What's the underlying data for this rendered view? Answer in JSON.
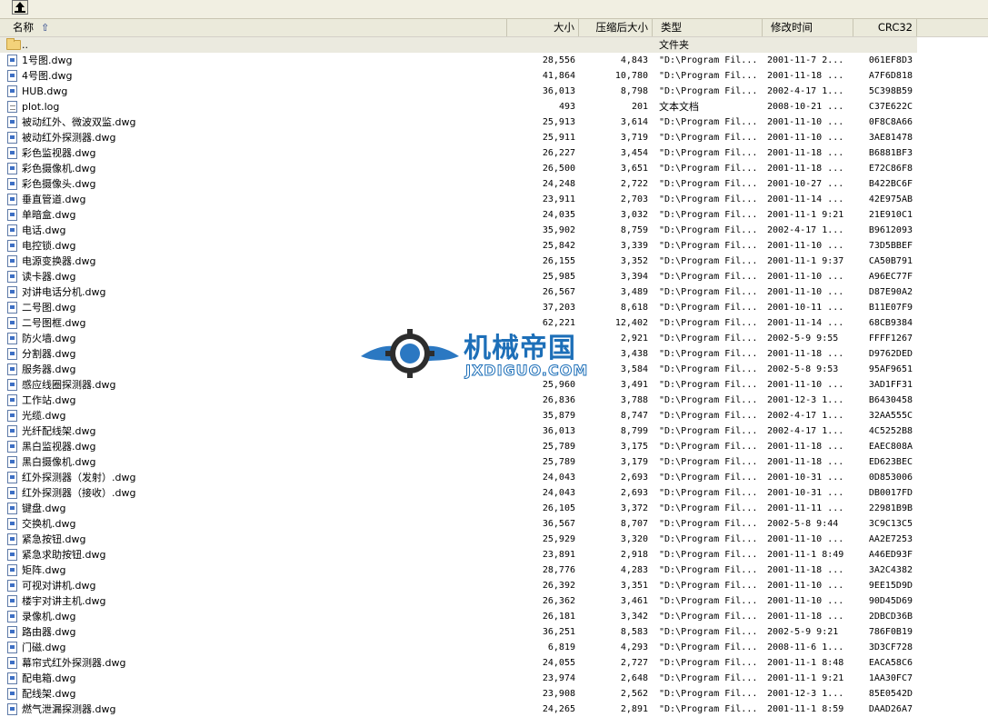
{
  "columns": {
    "name": "名称",
    "size": "大小",
    "compressed": "压缩后大小",
    "type": "类型",
    "modified": "修改时间",
    "crc": "CRC32"
  },
  "icons": {
    "up": "up-folder-icon",
    "sort": "sort-ascending-icon",
    "folder": "folder-icon",
    "dwg": "dwg-file-icon",
    "log": "text-file-icon"
  },
  "colors": {
    "header_bg": "#ebeadb",
    "selected_row_bg": "#ebeadf",
    "watermark_blue": "#1d6fb8"
  },
  "watermark": {
    "cn": "机械帝国",
    "en": "JXDIGUO.COM"
  },
  "rows": [
    {
      "name": "..",
      "size": "",
      "compressed": "",
      "type": "文件夹",
      "modified": "",
      "crc": "",
      "icon": "folder"
    },
    {
      "name": "1号图.dwg",
      "size": "28,556",
      "compressed": "4,843",
      "type": "\"D:\\Program Fil...",
      "modified": "2001-11-7 2...",
      "crc": "061EF8D3",
      "icon": "dwg"
    },
    {
      "name": "4号图.dwg",
      "size": "41,864",
      "compressed": "10,780",
      "type": "\"D:\\Program Fil...",
      "modified": "2001-11-18 ...",
      "crc": "A7F6D818",
      "icon": "dwg"
    },
    {
      "name": "HUB.dwg",
      "size": "36,013",
      "compressed": "8,798",
      "type": "\"D:\\Program Fil...",
      "modified": "2002-4-17 1...",
      "crc": "5C398B59",
      "icon": "dwg"
    },
    {
      "name": "plot.log",
      "size": "493",
      "compressed": "201",
      "type": "文本文档",
      "modified": "2008-10-21 ...",
      "crc": "C37E622C",
      "icon": "log"
    },
    {
      "name": "被动红外、微波双监.dwg",
      "size": "25,913",
      "compressed": "3,614",
      "type": "\"D:\\Program Fil...",
      "modified": "2001-11-10 ...",
      "crc": "0F8C8A66",
      "icon": "dwg"
    },
    {
      "name": "被动红外探测器.dwg",
      "size": "25,911",
      "compressed": "3,719",
      "type": "\"D:\\Program Fil...",
      "modified": "2001-11-10 ...",
      "crc": "3AE81478",
      "icon": "dwg"
    },
    {
      "name": "彩色监视器.dwg",
      "size": "26,227",
      "compressed": "3,454",
      "type": "\"D:\\Program Fil...",
      "modified": "2001-11-18 ...",
      "crc": "B6881BF3",
      "icon": "dwg"
    },
    {
      "name": "彩色摄像机.dwg",
      "size": "26,500",
      "compressed": "3,651",
      "type": "\"D:\\Program Fil...",
      "modified": "2001-11-18 ...",
      "crc": "E72C86F8",
      "icon": "dwg"
    },
    {
      "name": "彩色摄像头.dwg",
      "size": "24,248",
      "compressed": "2,722",
      "type": "\"D:\\Program Fil...",
      "modified": "2001-10-27 ...",
      "crc": "B422BC6F",
      "icon": "dwg"
    },
    {
      "name": "垂直管道.dwg",
      "size": "23,911",
      "compressed": "2,703",
      "type": "\"D:\\Program Fil...",
      "modified": "2001-11-14 ...",
      "crc": "42E975AB",
      "icon": "dwg"
    },
    {
      "name": "单暗盒.dwg",
      "size": "24,035",
      "compressed": "3,032",
      "type": "\"D:\\Program Fil...",
      "modified": "2001-11-1 9:21",
      "crc": "21E910C1",
      "icon": "dwg"
    },
    {
      "name": "电话.dwg",
      "size": "35,902",
      "compressed": "8,759",
      "type": "\"D:\\Program Fil...",
      "modified": "2002-4-17 1...",
      "crc": "B9612093",
      "icon": "dwg"
    },
    {
      "name": "电控锁.dwg",
      "size": "25,842",
      "compressed": "3,339",
      "type": "\"D:\\Program Fil...",
      "modified": "2001-11-10 ...",
      "crc": "73D5BBEF",
      "icon": "dwg"
    },
    {
      "name": "电源变换器.dwg",
      "size": "26,155",
      "compressed": "3,352",
      "type": "\"D:\\Program Fil...",
      "modified": "2001-11-1 9:37",
      "crc": "CA50B791",
      "icon": "dwg"
    },
    {
      "name": "读卡器.dwg",
      "size": "25,985",
      "compressed": "3,394",
      "type": "\"D:\\Program Fil...",
      "modified": "2001-11-10 ...",
      "crc": "A96EC77F",
      "icon": "dwg"
    },
    {
      "name": "对讲电话分机.dwg",
      "size": "26,567",
      "compressed": "3,489",
      "type": "\"D:\\Program Fil...",
      "modified": "2001-11-10 ...",
      "crc": "D87E90A2",
      "icon": "dwg"
    },
    {
      "name": "二号图.dwg",
      "size": "37,203",
      "compressed": "8,618",
      "type": "\"D:\\Program Fil...",
      "modified": "2001-10-11 ...",
      "crc": "B11E07F9",
      "icon": "dwg"
    },
    {
      "name": "二号图框.dwg",
      "size": "62,221",
      "compressed": "12,402",
      "type": "\"D:\\Program Fil...",
      "modified": "2001-11-14 ...",
      "crc": "68CB9384",
      "icon": "dwg"
    },
    {
      "name": "防火墙.dwg",
      "size": "",
      "compressed": "2,921",
      "type": "\"D:\\Program Fil...",
      "modified": "2002-5-9 9:55",
      "crc": "FFFF1267",
      "icon": "dwg"
    },
    {
      "name": "分割器.dwg",
      "size": "",
      "compressed": "3,438",
      "type": "\"D:\\Program Fil...",
      "modified": "2001-11-18 ...",
      "crc": "D9762DED",
      "icon": "dwg"
    },
    {
      "name": "服务器.dwg",
      "size": "",
      "compressed": "3,584",
      "type": "\"D:\\Program Fil...",
      "modified": "2002-5-8 9:53",
      "crc": "95AF9651",
      "icon": "dwg"
    },
    {
      "name": "感应线圈探测器.dwg",
      "size": "25,960",
      "compressed": "3,491",
      "type": "\"D:\\Program Fil...",
      "modified": "2001-11-10 ...",
      "crc": "3AD1FF31",
      "icon": "dwg"
    },
    {
      "name": "工作站.dwg",
      "size": "26,836",
      "compressed": "3,788",
      "type": "\"D:\\Program Fil...",
      "modified": "2001-12-3 1...",
      "crc": "B6430458",
      "icon": "dwg"
    },
    {
      "name": "光缆.dwg",
      "size": "35,879",
      "compressed": "8,747",
      "type": "\"D:\\Program Fil...",
      "modified": "2002-4-17 1...",
      "crc": "32AA555C",
      "icon": "dwg"
    },
    {
      "name": "光纤配线架.dwg",
      "size": "36,013",
      "compressed": "8,799",
      "type": "\"D:\\Program Fil...",
      "modified": "2002-4-17 1...",
      "crc": "4C5252B8",
      "icon": "dwg"
    },
    {
      "name": "黑白监视器.dwg",
      "size": "25,789",
      "compressed": "3,175",
      "type": "\"D:\\Program Fil...",
      "modified": "2001-11-18 ...",
      "crc": "EAEC808A",
      "icon": "dwg"
    },
    {
      "name": "黑白摄像机.dwg",
      "size": "25,789",
      "compressed": "3,179",
      "type": "\"D:\\Program Fil...",
      "modified": "2001-11-18 ...",
      "crc": "ED623BEC",
      "icon": "dwg"
    },
    {
      "name": "红外探测器（发射）.dwg",
      "size": "24,043",
      "compressed": "2,693",
      "type": "\"D:\\Program Fil...",
      "modified": "2001-10-31 ...",
      "crc": "0D853006",
      "icon": "dwg"
    },
    {
      "name": "红外探测器（接收）.dwg",
      "size": "24,043",
      "compressed": "2,693",
      "type": "\"D:\\Program Fil...",
      "modified": "2001-10-31 ...",
      "crc": "DB0017FD",
      "icon": "dwg"
    },
    {
      "name": "键盘.dwg",
      "size": "26,105",
      "compressed": "3,372",
      "type": "\"D:\\Program Fil...",
      "modified": "2001-11-11 ...",
      "crc": "22981B9B",
      "icon": "dwg"
    },
    {
      "name": "交换机.dwg",
      "size": "36,567",
      "compressed": "8,707",
      "type": "\"D:\\Program Fil...",
      "modified": "2002-5-8 9:44",
      "crc": "3C9C13C5",
      "icon": "dwg"
    },
    {
      "name": "紧急按钮.dwg",
      "size": "25,929",
      "compressed": "3,320",
      "type": "\"D:\\Program Fil...",
      "modified": "2001-11-10 ...",
      "crc": "AA2E7253",
      "icon": "dwg"
    },
    {
      "name": "紧急求助按钮.dwg",
      "size": "23,891",
      "compressed": "2,918",
      "type": "\"D:\\Program Fil...",
      "modified": "2001-11-1 8:49",
      "crc": "A46ED93F",
      "icon": "dwg"
    },
    {
      "name": "矩阵.dwg",
      "size": "28,776",
      "compressed": "4,283",
      "type": "\"D:\\Program Fil...",
      "modified": "2001-11-18 ...",
      "crc": "3A2C4382",
      "icon": "dwg"
    },
    {
      "name": "可视对讲机.dwg",
      "size": "26,392",
      "compressed": "3,351",
      "type": "\"D:\\Program Fil...",
      "modified": "2001-11-10 ...",
      "crc": "9EE15D9D",
      "icon": "dwg"
    },
    {
      "name": "楼宇对讲主机.dwg",
      "size": "26,362",
      "compressed": "3,461",
      "type": "\"D:\\Program Fil...",
      "modified": "2001-11-10 ...",
      "crc": "90D45D69",
      "icon": "dwg"
    },
    {
      "name": "录像机.dwg",
      "size": "26,181",
      "compressed": "3,342",
      "type": "\"D:\\Program Fil...",
      "modified": "2001-11-18 ...",
      "crc": "2DBCD36B",
      "icon": "dwg"
    },
    {
      "name": "路由器.dwg",
      "size": "36,251",
      "compressed": "8,583",
      "type": "\"D:\\Program Fil...",
      "modified": "2002-5-9 9:21",
      "crc": "786F0B19",
      "icon": "dwg"
    },
    {
      "name": "门磁.dwg",
      "size": "6,819",
      "compressed": "4,293",
      "type": "\"D:\\Program Fil...",
      "modified": "2008-11-6 1...",
      "crc": "3D3CF728",
      "icon": "dwg"
    },
    {
      "name": "幕帘式红外探测器.dwg",
      "size": "24,055",
      "compressed": "2,727",
      "type": "\"D:\\Program Fil...",
      "modified": "2001-11-1 8:48",
      "crc": "EACA58C6",
      "icon": "dwg"
    },
    {
      "name": "配电箱.dwg",
      "size": "23,974",
      "compressed": "2,648",
      "type": "\"D:\\Program Fil...",
      "modified": "2001-11-1 9:21",
      "crc": "1AA30FC7",
      "icon": "dwg"
    },
    {
      "name": "配线架.dwg",
      "size": "23,908",
      "compressed": "2,562",
      "type": "\"D:\\Program Fil...",
      "modified": "2001-12-3 1...",
      "crc": "85E0542D",
      "icon": "dwg"
    },
    {
      "name": "燃气泄漏探测器.dwg",
      "size": "24,265",
      "compressed": "2,891",
      "type": "\"D:\\Program Fil...",
      "modified": "2001-11-1 8:59",
      "crc": "DAAD26A7",
      "icon": "dwg"
    }
  ]
}
